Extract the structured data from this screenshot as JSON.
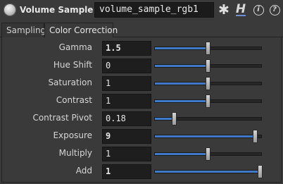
{
  "header": {
    "node_type": "Volume Sample RGB",
    "node_name": "volume_sample_rgb1",
    "icons": [
      "sphere-node-icon",
      "gear-icon",
      "houdini-help-icon",
      "info-icon",
      "help-icon"
    ]
  },
  "tabs": [
    {
      "label": "Sampling",
      "active": false
    },
    {
      "label": "Color Correction",
      "active": true
    }
  ],
  "colors": {
    "accent": "#3f79c8",
    "field_bg": "#1e1e1e",
    "panel_bg": "#3a3a3a"
  },
  "params": [
    {
      "label": "Gamma",
      "value": "1.5",
      "bold": true,
      "slider": 0.5
    },
    {
      "label": "Hue Shift",
      "value": "0",
      "bold": false,
      "slider": 0.5
    },
    {
      "label": "Saturation",
      "value": "1",
      "bold": false,
      "slider": 0.5
    },
    {
      "label": "Contrast",
      "value": "1",
      "bold": false,
      "slider": 0.5
    },
    {
      "label": "Contrast Pivot",
      "value": "0.18",
      "bold": false,
      "slider": 0.18
    },
    {
      "label": "Exposure",
      "value": "9",
      "bold": true,
      "slider": 0.95
    },
    {
      "label": "Multiply",
      "value": "1",
      "bold": false,
      "slider": 0.5
    },
    {
      "label": "Add",
      "value": "1",
      "bold": true,
      "slider": 1.0
    }
  ]
}
